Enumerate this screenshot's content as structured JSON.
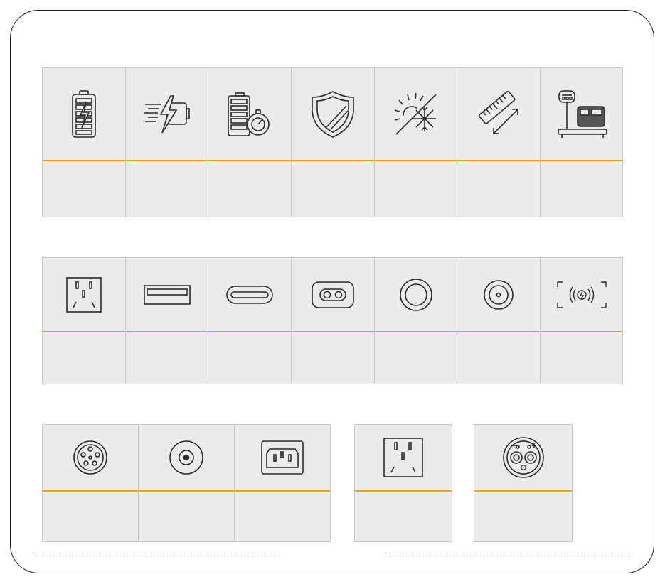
{
  "colors": {
    "accent": "#f0a020",
    "cell_bg": "#ebebeb",
    "cell_border": "#c8c8c8",
    "icon_stroke": "#2b2b2b"
  },
  "row1": {
    "cells": [
      {
        "icon": "battery-charging-icon",
        "label": ""
      },
      {
        "icon": "fast-charge-icon",
        "label": ""
      },
      {
        "icon": "battery-timer-icon",
        "label": ""
      },
      {
        "icon": "shield-icon",
        "label": ""
      },
      {
        "icon": "sun-snowflake-icon",
        "label": ""
      },
      {
        "icon": "ruler-icon",
        "label": ""
      },
      {
        "icon": "weight-scale-icon",
        "label": ""
      }
    ]
  },
  "row2": {
    "cells": [
      {
        "icon": "ac-outlet-icon",
        "label": ""
      },
      {
        "icon": "usb-a-port-icon",
        "label": ""
      },
      {
        "icon": "usb-c-port-icon",
        "label": ""
      },
      {
        "icon": "car-socket-port-icon",
        "label": ""
      },
      {
        "icon": "round-port-icon",
        "label": ""
      },
      {
        "icon": "dc-port-icon",
        "label": ""
      },
      {
        "icon": "wireless-charging-icon",
        "label": ""
      }
    ]
  },
  "row3": {
    "cells": [
      {
        "icon": "aviation-connector-icon",
        "label": ""
      },
      {
        "icon": "dc-barrel-jack-icon",
        "label": ""
      },
      {
        "icon": "iec-c14-inlet-icon",
        "label": ""
      }
    ]
  },
  "row3_extra": [
    {
      "icon": "ac-outlet-icon",
      "label": ""
    },
    {
      "icon": "anderson-connector-icon",
      "label": ""
    }
  ]
}
